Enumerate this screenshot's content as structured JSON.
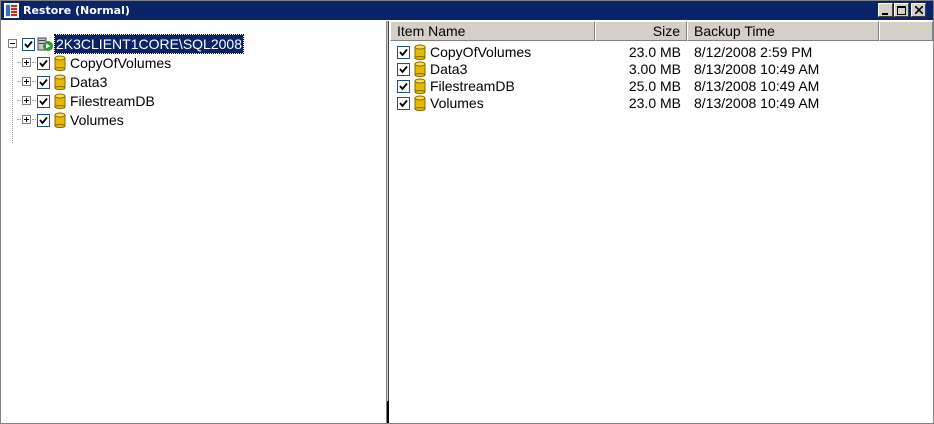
{
  "window": {
    "title": "Restore (Normal)",
    "controls": {
      "minimize_icon": "minimize-icon",
      "restore_icon": "restore-icon",
      "close_icon": "close-icon"
    }
  },
  "tree": {
    "root": {
      "label": "2K3CLIENT1CORE\\SQL2008",
      "checked": true,
      "expanded": true,
      "icon": "server-icon"
    },
    "children": [
      {
        "label": "CopyOfVolumes",
        "checked": true,
        "icon": "database-icon"
      },
      {
        "label": "Data3",
        "checked": true,
        "icon": "database-icon"
      },
      {
        "label": "FilestreamDB",
        "checked": true,
        "icon": "database-icon"
      },
      {
        "label": "Volumes",
        "checked": true,
        "icon": "database-icon"
      }
    ]
  },
  "list": {
    "columns": [
      "Item Name",
      "Size",
      "Backup Time"
    ],
    "rows": [
      {
        "name": "CopyOfVolumes",
        "size": "23.0 MB",
        "backup_time": "8/12/2008 2:59 PM",
        "checked": true
      },
      {
        "name": "Data3",
        "size": "3.00 MB",
        "backup_time": "8/13/2008 10:49 AM",
        "checked": true
      },
      {
        "name": "FilestreamDB",
        "size": "25.0 MB",
        "backup_time": "8/13/2008 10:49 AM",
        "checked": true
      },
      {
        "name": "Volumes",
        "size": "23.0 MB",
        "backup_time": "8/13/2008 10:49 AM",
        "checked": true
      }
    ]
  },
  "colors": {
    "titlebar": "#0a246a",
    "selection": "#0a246a",
    "database_icon": "#e8b800",
    "chrome": "#d4d0c8"
  }
}
